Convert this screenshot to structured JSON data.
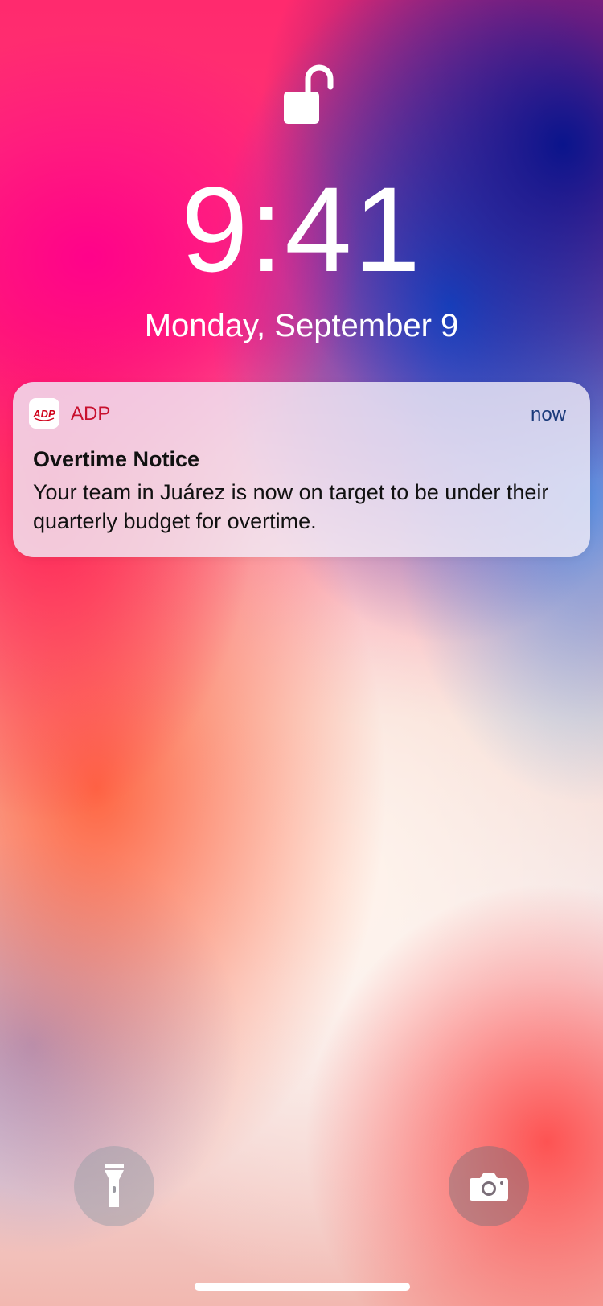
{
  "lockscreen": {
    "time": "9:41",
    "date": "Monday, September 9"
  },
  "notification": {
    "app_icon": "adp-logo-icon",
    "app_name": "ADP",
    "time": "now",
    "title": "Overtime Notice",
    "body": "Your team in Juárez is now on target to be under their quarterly budget for overtime."
  },
  "quick_actions": {
    "left_icon": "flashlight-icon",
    "right_icon": "camera-icon"
  },
  "colors": {
    "app_name": "#c8102e",
    "notif_time": "#1a3a7a"
  }
}
